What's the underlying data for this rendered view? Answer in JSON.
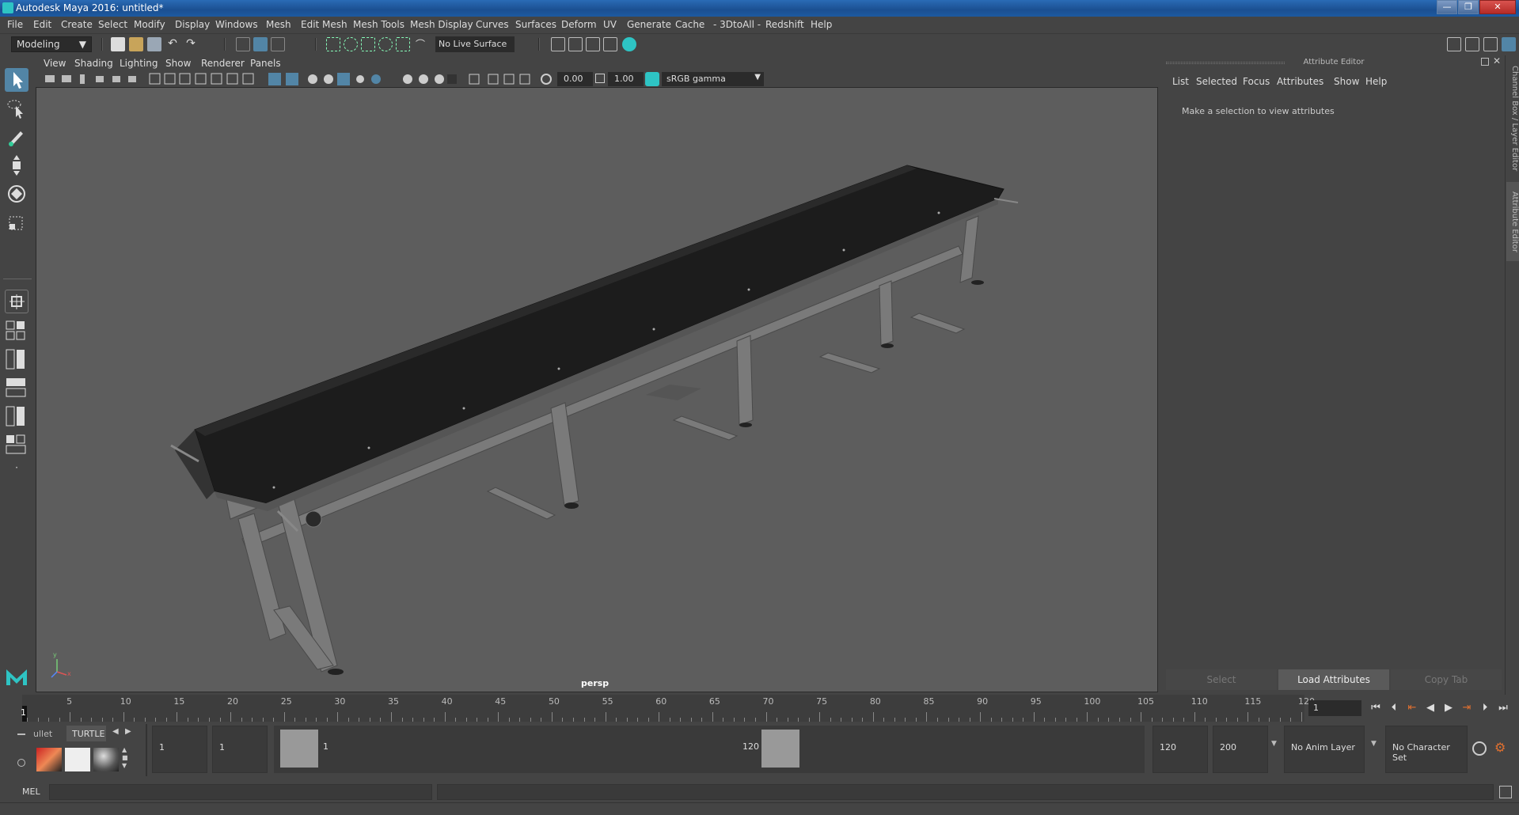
{
  "window": {
    "title": "Autodesk Maya 2016: untitled*",
    "min_label": "—",
    "max_label": "❐",
    "close_label": "✕"
  },
  "menus": [
    "File",
    "Edit",
    "Create",
    "Select",
    "Modify",
    "Display",
    "Windows",
    "Mesh",
    "Edit Mesh",
    "Mesh Tools",
    "Mesh Display",
    "Curves",
    "Surfaces",
    "Deform",
    "UV",
    "Generate",
    "Cache",
    "- 3DtoAll -",
    "Redshift",
    "Help"
  ],
  "statusline": {
    "mode": "Modeling",
    "live_surface": "No Live Surface"
  },
  "viewport": {
    "menus": [
      "View",
      "Shading",
      "Lighting",
      "Show",
      "Renderer",
      "Panels"
    ],
    "exposure": "0.00",
    "gamma": "1.00",
    "color_space": "sRGB gamma",
    "camera_label": "persp"
  },
  "attribute_editor": {
    "title": "Attribute Editor",
    "menus": [
      "List",
      "Selected",
      "Focus",
      "Attributes",
      "Show",
      "Help"
    ],
    "message": "Make a selection to view attributes",
    "buttons": {
      "select": "Select",
      "load": "Load Attributes",
      "copy": "Copy Tab"
    }
  },
  "side_tabs": {
    "channel_box": "Channel Box / Layer Editor",
    "attribute_editor": "Attribute Editor"
  },
  "timeline": {
    "ticks": [
      "5",
      "10",
      "15",
      "20",
      "25",
      "30",
      "35",
      "40",
      "45",
      "50",
      "55",
      "60",
      "65",
      "70",
      "75",
      "80",
      "85",
      "90",
      "95",
      "100",
      "105",
      "110",
      "115",
      "120"
    ],
    "current_frame_marker": "1",
    "current_frame": "1"
  },
  "range": {
    "start": "1",
    "playback_start": "1",
    "range_start_label": "1",
    "range_end_label": "120",
    "playback_end": "120",
    "end": "200",
    "anim_layer": "No Anim Layer",
    "character_set": "No Character Set"
  },
  "shelf": {
    "tabs": [
      "ullet",
      "TURTLE"
    ]
  },
  "cmdline": {
    "label": "MEL"
  },
  "colors": {
    "accent": "#2ec4c4",
    "selected_tool": "#5285a6",
    "viewport_bg": "#5d5d5d"
  }
}
